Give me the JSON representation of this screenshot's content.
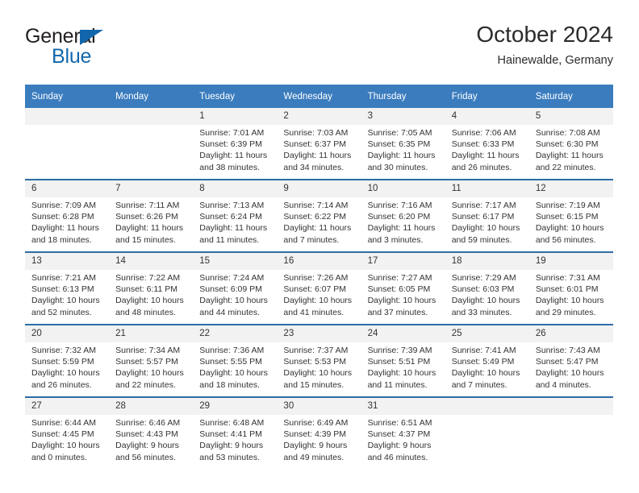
{
  "brand": {
    "word1": "General",
    "word2": "Blue",
    "triangle_color": "#1266ac"
  },
  "header": {
    "title": "October 2024",
    "subtitle": "Hainewalde, Germany"
  },
  "colors": {
    "header_bar": "#3a7cbe",
    "row_divider": "#2e6da4",
    "daynum_bg": "#f2f2f2",
    "text": "#333333"
  },
  "labels": {
    "sunrise_prefix": "Sunrise:",
    "sunset_prefix": "Sunset:",
    "daylight_prefix": "Daylight:"
  },
  "weekdays": [
    "Sunday",
    "Monday",
    "Tuesday",
    "Wednesday",
    "Thursday",
    "Friday",
    "Saturday"
  ],
  "weeks": [
    [
      {
        "day": "",
        "blank": true
      },
      {
        "day": "",
        "blank": true
      },
      {
        "day": "1",
        "sunrise": "Sunrise: 7:01 AM",
        "sunset": "Sunset: 6:39 PM",
        "daylight1": "Daylight: 11 hours",
        "daylight2": "and 38 minutes."
      },
      {
        "day": "2",
        "sunrise": "Sunrise: 7:03 AM",
        "sunset": "Sunset: 6:37 PM",
        "daylight1": "Daylight: 11 hours",
        "daylight2": "and 34 minutes."
      },
      {
        "day": "3",
        "sunrise": "Sunrise: 7:05 AM",
        "sunset": "Sunset: 6:35 PM",
        "daylight1": "Daylight: 11 hours",
        "daylight2": "and 30 minutes."
      },
      {
        "day": "4",
        "sunrise": "Sunrise: 7:06 AM",
        "sunset": "Sunset: 6:33 PM",
        "daylight1": "Daylight: 11 hours",
        "daylight2": "and 26 minutes."
      },
      {
        "day": "5",
        "sunrise": "Sunrise: 7:08 AM",
        "sunset": "Sunset: 6:30 PM",
        "daylight1": "Daylight: 11 hours",
        "daylight2": "and 22 minutes."
      }
    ],
    [
      {
        "day": "6",
        "sunrise": "Sunrise: 7:09 AM",
        "sunset": "Sunset: 6:28 PM",
        "daylight1": "Daylight: 11 hours",
        "daylight2": "and 18 minutes."
      },
      {
        "day": "7",
        "sunrise": "Sunrise: 7:11 AM",
        "sunset": "Sunset: 6:26 PM",
        "daylight1": "Daylight: 11 hours",
        "daylight2": "and 15 minutes."
      },
      {
        "day": "8",
        "sunrise": "Sunrise: 7:13 AM",
        "sunset": "Sunset: 6:24 PM",
        "daylight1": "Daylight: 11 hours",
        "daylight2": "and 11 minutes."
      },
      {
        "day": "9",
        "sunrise": "Sunrise: 7:14 AM",
        "sunset": "Sunset: 6:22 PM",
        "daylight1": "Daylight: 11 hours",
        "daylight2": "and 7 minutes."
      },
      {
        "day": "10",
        "sunrise": "Sunrise: 7:16 AM",
        "sunset": "Sunset: 6:20 PM",
        "daylight1": "Daylight: 11 hours",
        "daylight2": "and 3 minutes."
      },
      {
        "day": "11",
        "sunrise": "Sunrise: 7:17 AM",
        "sunset": "Sunset: 6:17 PM",
        "daylight1": "Daylight: 10 hours",
        "daylight2": "and 59 minutes."
      },
      {
        "day": "12",
        "sunrise": "Sunrise: 7:19 AM",
        "sunset": "Sunset: 6:15 PM",
        "daylight1": "Daylight: 10 hours",
        "daylight2": "and 56 minutes."
      }
    ],
    [
      {
        "day": "13",
        "sunrise": "Sunrise: 7:21 AM",
        "sunset": "Sunset: 6:13 PM",
        "daylight1": "Daylight: 10 hours",
        "daylight2": "and 52 minutes."
      },
      {
        "day": "14",
        "sunrise": "Sunrise: 7:22 AM",
        "sunset": "Sunset: 6:11 PM",
        "daylight1": "Daylight: 10 hours",
        "daylight2": "and 48 minutes."
      },
      {
        "day": "15",
        "sunrise": "Sunrise: 7:24 AM",
        "sunset": "Sunset: 6:09 PM",
        "daylight1": "Daylight: 10 hours",
        "daylight2": "and 44 minutes."
      },
      {
        "day": "16",
        "sunrise": "Sunrise: 7:26 AM",
        "sunset": "Sunset: 6:07 PM",
        "daylight1": "Daylight: 10 hours",
        "daylight2": "and 41 minutes."
      },
      {
        "day": "17",
        "sunrise": "Sunrise: 7:27 AM",
        "sunset": "Sunset: 6:05 PM",
        "daylight1": "Daylight: 10 hours",
        "daylight2": "and 37 minutes."
      },
      {
        "day": "18",
        "sunrise": "Sunrise: 7:29 AM",
        "sunset": "Sunset: 6:03 PM",
        "daylight1": "Daylight: 10 hours",
        "daylight2": "and 33 minutes."
      },
      {
        "day": "19",
        "sunrise": "Sunrise: 7:31 AM",
        "sunset": "Sunset: 6:01 PM",
        "daylight1": "Daylight: 10 hours",
        "daylight2": "and 29 minutes."
      }
    ],
    [
      {
        "day": "20",
        "sunrise": "Sunrise: 7:32 AM",
        "sunset": "Sunset: 5:59 PM",
        "daylight1": "Daylight: 10 hours",
        "daylight2": "and 26 minutes."
      },
      {
        "day": "21",
        "sunrise": "Sunrise: 7:34 AM",
        "sunset": "Sunset: 5:57 PM",
        "daylight1": "Daylight: 10 hours",
        "daylight2": "and 22 minutes."
      },
      {
        "day": "22",
        "sunrise": "Sunrise: 7:36 AM",
        "sunset": "Sunset: 5:55 PM",
        "daylight1": "Daylight: 10 hours",
        "daylight2": "and 18 minutes."
      },
      {
        "day": "23",
        "sunrise": "Sunrise: 7:37 AM",
        "sunset": "Sunset: 5:53 PM",
        "daylight1": "Daylight: 10 hours",
        "daylight2": "and 15 minutes."
      },
      {
        "day": "24",
        "sunrise": "Sunrise: 7:39 AM",
        "sunset": "Sunset: 5:51 PM",
        "daylight1": "Daylight: 10 hours",
        "daylight2": "and 11 minutes."
      },
      {
        "day": "25",
        "sunrise": "Sunrise: 7:41 AM",
        "sunset": "Sunset: 5:49 PM",
        "daylight1": "Daylight: 10 hours",
        "daylight2": "and 7 minutes."
      },
      {
        "day": "26",
        "sunrise": "Sunrise: 7:43 AM",
        "sunset": "Sunset: 5:47 PM",
        "daylight1": "Daylight: 10 hours",
        "daylight2": "and 4 minutes."
      }
    ],
    [
      {
        "day": "27",
        "sunrise": "Sunrise: 6:44 AM",
        "sunset": "Sunset: 4:45 PM",
        "daylight1": "Daylight: 10 hours",
        "daylight2": "and 0 minutes."
      },
      {
        "day": "28",
        "sunrise": "Sunrise: 6:46 AM",
        "sunset": "Sunset: 4:43 PM",
        "daylight1": "Daylight: 9 hours",
        "daylight2": "and 56 minutes."
      },
      {
        "day": "29",
        "sunrise": "Sunrise: 6:48 AM",
        "sunset": "Sunset: 4:41 PM",
        "daylight1": "Daylight: 9 hours",
        "daylight2": "and 53 minutes."
      },
      {
        "day": "30",
        "sunrise": "Sunrise: 6:49 AM",
        "sunset": "Sunset: 4:39 PM",
        "daylight1": "Daylight: 9 hours",
        "daylight2": "and 49 minutes."
      },
      {
        "day": "31",
        "sunrise": "Sunrise: 6:51 AM",
        "sunset": "Sunset: 4:37 PM",
        "daylight1": "Daylight: 9 hours",
        "daylight2": "and 46 minutes."
      },
      {
        "day": "",
        "blank": true
      },
      {
        "day": "",
        "blank": true
      }
    ]
  ]
}
